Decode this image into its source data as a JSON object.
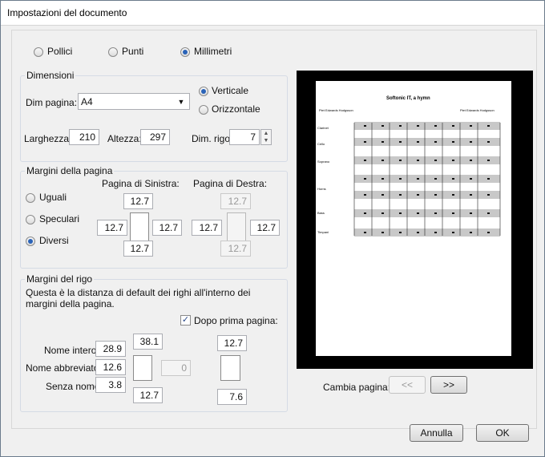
{
  "window": {
    "title": "Impostazioni del documento"
  },
  "units": {
    "options": [
      {
        "label": "Pollici",
        "checked": false
      },
      {
        "label": "Punti",
        "checked": false
      },
      {
        "label": "Millimetri",
        "checked": true
      }
    ]
  },
  "dimensions": {
    "title": "Dimensioni",
    "page_size_label": "Dim pagina:",
    "page_size_value": "A4",
    "orientation": [
      {
        "label": "Verticale",
        "checked": true
      },
      {
        "label": "Orizzontale",
        "checked": false
      }
    ],
    "width_label": "Larghezza:",
    "width_value": "210",
    "height_label": "Altezza:",
    "height_value": "297",
    "staff_size_label": "Dim. rigo:",
    "staff_size_value": "7"
  },
  "page_margins": {
    "title": "Margini della pagina",
    "options": [
      {
        "label": "Uguali",
        "checked": false
      },
      {
        "label": "Speculari",
        "checked": false
      },
      {
        "label": "Diversi",
        "checked": true
      }
    ],
    "left_page_label": "Pagina di Sinistra:",
    "right_page_label": "Pagina di Destra:",
    "left": {
      "top": "12.7",
      "left": "12.7",
      "right": "12.7",
      "bottom": "12.7"
    },
    "right": {
      "top": "12.7",
      "left": "12.7",
      "right": "12.7",
      "bottom": "12.7"
    }
  },
  "staff_margins": {
    "title": "Margini del rigo",
    "description": "Questa è la distanza di default dei righi all'interno dei margini della pagina.",
    "after_first_page_label": "Dopo prima pagina:",
    "after_first_page_checked": true,
    "full_name_label": "Nome intero:",
    "full_name_value": "28.9",
    "short_name_label": "Nome abbreviato:",
    "short_name_value": "12.6",
    "no_name_label": "Senza nome:",
    "no_name_value": "3.8",
    "first_top": "38.1",
    "first_right": "0",
    "first_bottom": "12.7",
    "after_top": "12.7",
    "after_bottom": "7.6"
  },
  "preview": {
    "score_title": "Softonic IT, a hymn",
    "composer_left": "Piet Edwards Hodgsson",
    "composer_right": "Piet Edwards Hodgsson",
    "instruments": [
      "Clarinet",
      "Cello",
      "Soprano",
      "Horns",
      "Piano",
      "Bass",
      "Timpani"
    ]
  },
  "page_nav": {
    "label": "Cambia pagina:",
    "prev": "<<",
    "next": ">>"
  },
  "buttons": {
    "cancel": "Annulla",
    "ok": "OK"
  }
}
